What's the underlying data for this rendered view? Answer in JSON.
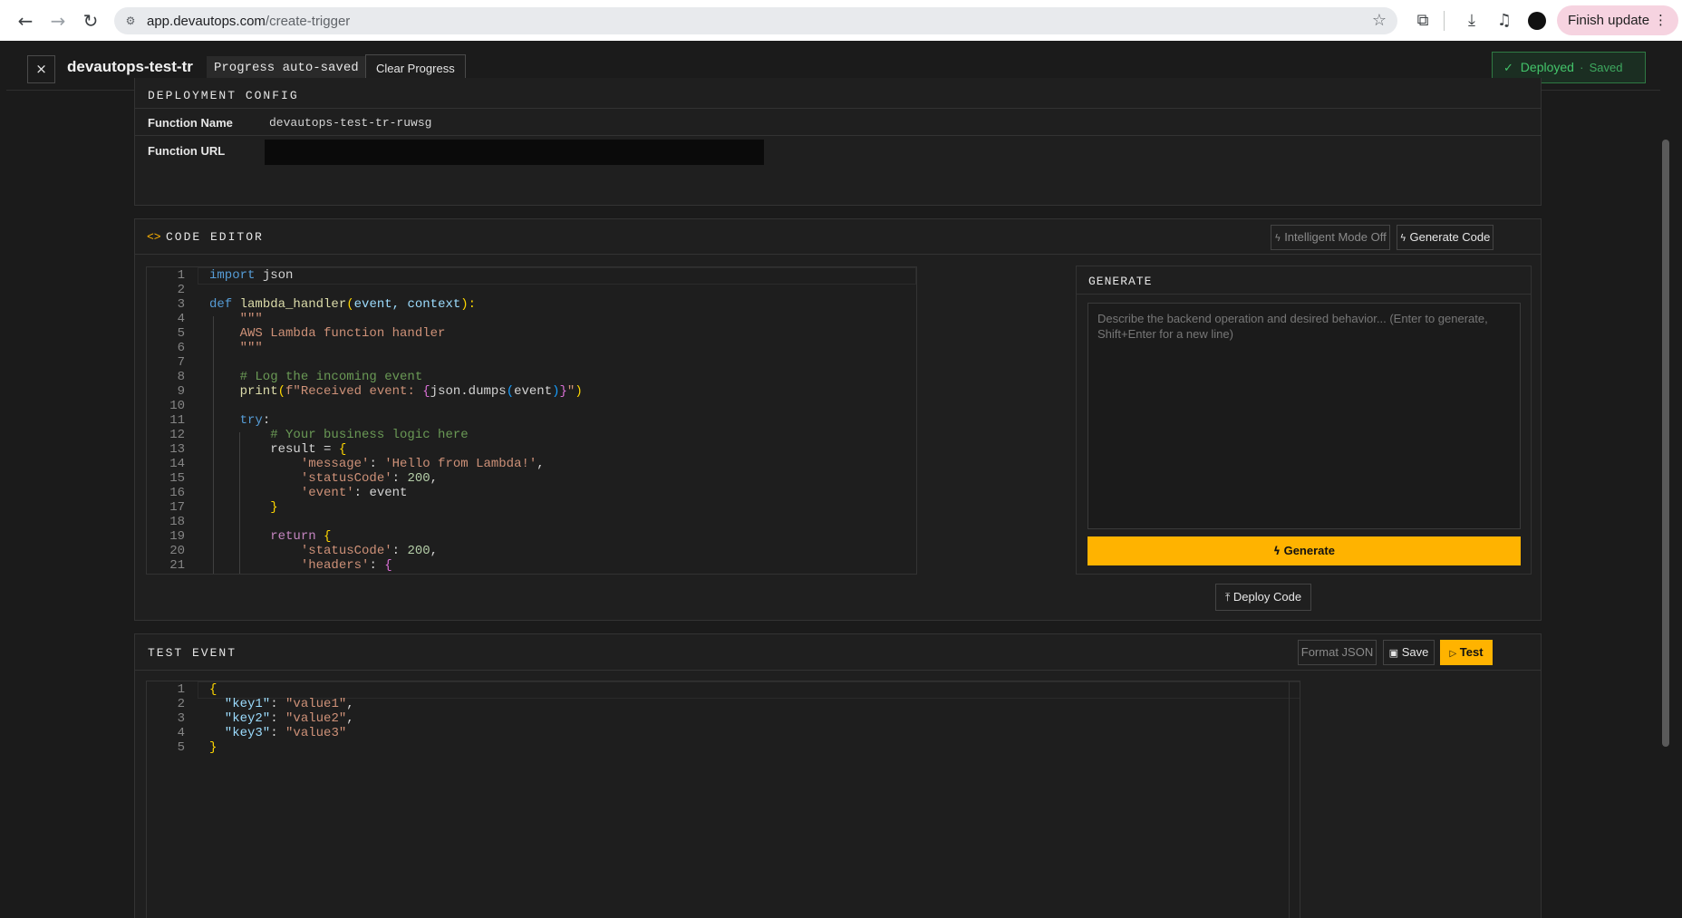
{
  "browser": {
    "url_domain": "app.devautops.com",
    "url_path": "/create-trigger",
    "finish_update_label": "Finish update"
  },
  "header": {
    "close_icon": "×",
    "app_title": "devautops-test-tr",
    "autosave_badge": "Progress auto-saved",
    "clear_progress_label": "Clear Progress",
    "status_deployed": "Deployed",
    "status_saved": "Saved"
  },
  "deployment_config": {
    "title": "DEPLOYMENT CONFIG",
    "function_name_label": "Function Name",
    "function_name_value": "devautops-test-tr-ruwsg",
    "function_url_label": "Function URL"
  },
  "code_editor": {
    "title": "CODE EDITOR",
    "intelligent_mode_label": "Intelligent Mode Off",
    "generate_code_label": "Generate Code",
    "deploy_code_label": "Deploy Code",
    "line_numbers": [
      "1",
      "2",
      "3",
      "4",
      "5",
      "6",
      "7",
      "8",
      "9",
      "10",
      "11",
      "12",
      "13",
      "14",
      "15",
      "16",
      "17",
      "18",
      "19",
      "20",
      "21"
    ],
    "lines": {
      "l1_a": "import",
      "l1_b": " json",
      "l3_a": "def",
      "l3_b": " lambda_handler",
      "l3_c": "(",
      "l3_d": "event, context",
      "l3_e": "):",
      "l4": "    \"\"\"",
      "l5": "    AWS Lambda function handler",
      "l6": "    \"\"\"",
      "l8": "    # Log the incoming event",
      "l9_a": "    print",
      "l9_b": "(",
      "l9_c": "f\"Received event: ",
      "l9_d": "{",
      "l9_e": "json.dumps",
      "l9_f": "(",
      "l9_g": "event",
      "l9_h": ")",
      "l9_i": "}",
      "l9_j": "\"",
      "l9_k": ")",
      "l11_a": "    try",
      "l11_b": ":",
      "l12": "        # Your business logic here",
      "l13_a": "        result = ",
      "l13_b": "{",
      "l14_a": "            'message'",
      "l14_b": ": ",
      "l14_c": "'Hello from Lambda!'",
      "l14_d": ",",
      "l15_a": "            'statusCode'",
      "l15_b": ": ",
      "l15_c": "200",
      "l15_d": ",",
      "l16_a": "            'event'",
      "l16_b": ": event",
      "l17": "        }",
      "l19_a": "        return",
      "l19_b": " {",
      "l20_a": "            'statusCode'",
      "l20_b": ": ",
      "l20_c": "200",
      "l20_d": ",",
      "l21_a": "            'headers'",
      "l21_b": ": ",
      "l21_c": "{"
    }
  },
  "generate": {
    "title": "GENERATE",
    "placeholder": "Describe the backend operation and desired behavior... (Enter to generate, Shift+Enter for a new line)",
    "button_label": "Generate"
  },
  "test_event": {
    "title": "TEST EVENT",
    "format_json_label": "Format JSON",
    "save_label": "Save",
    "test_label": "Test",
    "line_numbers": [
      "1",
      "2",
      "3",
      "4",
      "5"
    ],
    "lines": {
      "l1": "{",
      "l2_k": "  \"key1\"",
      "l2_v": "\"value1\"",
      "l3_k": "  \"key2\"",
      "l3_v": "\"value2\"",
      "l4_k": "  \"key3\"",
      "l4_v": "\"value3\"",
      "l5": "}"
    }
  },
  "colors": {
    "accent": "#ffb300",
    "deployed_green": "#43c46a",
    "background": "#1b1b1b"
  }
}
